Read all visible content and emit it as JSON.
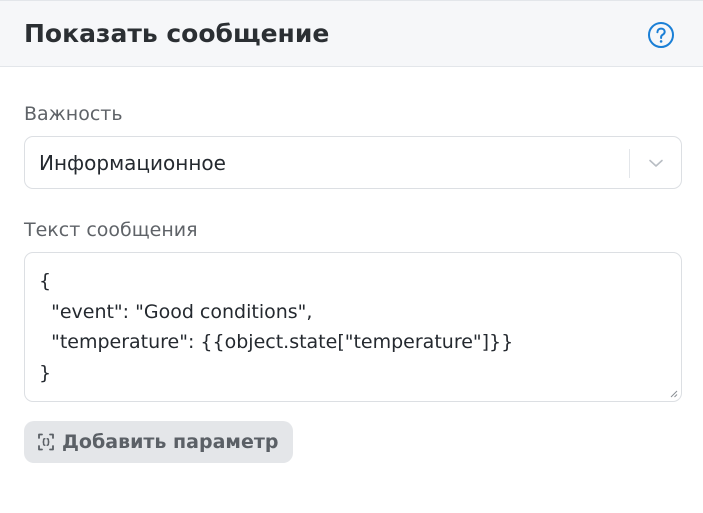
{
  "header": {
    "title": "Показать сообщение",
    "help_icon": "question-circle-icon",
    "accent_color": "#1a7fd6"
  },
  "importance": {
    "label": "Важность",
    "selected": "Информационное",
    "chevron_icon": "chevron-down-icon"
  },
  "message": {
    "label": "Текст сообщения",
    "value": "{\n  \"event\": \"Good conditions\",\n  \"temperature\": {{object.state[\"temperature\"]}}\n}"
  },
  "add_parameter": {
    "label": "Добавить параметр",
    "icon": "variable-brackets-icon"
  }
}
